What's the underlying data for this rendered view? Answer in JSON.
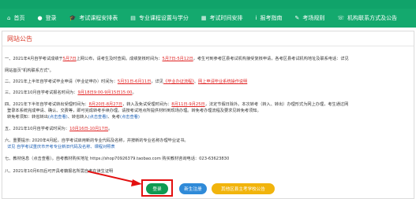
{
  "nav": {
    "items": [
      {
        "icon": "home-icon",
        "glyph": "⌂",
        "label": "首页"
      },
      {
        "icon": "user-icon",
        "glyph": "●",
        "label": "登录"
      },
      {
        "icon": "cap-icon",
        "glyph": "🎓",
        "label": "考试课程安排表"
      },
      {
        "icon": "book-icon",
        "glyph": "▤",
        "label": "专业课程设置与学分"
      },
      {
        "icon": "calendar-icon",
        "glyph": "▦",
        "label": "考试时间安排"
      },
      {
        "icon": "info-icon",
        "glyph": "i",
        "label": "报考指南"
      },
      {
        "icon": "pencil-icon",
        "glyph": "✎",
        "label": "考场规则"
      },
      {
        "icon": "phone-icon",
        "glyph": "☏",
        "label": "机构联系方式及公告"
      }
    ]
  },
  "notice": {
    "title": "网站公告",
    "lines": [
      [
        {
          "t": "一、2021年4月自学考试成绩于"
        },
        {
          "t": "5月7日",
          "c": "red ul"
        },
        {
          "t": "上网公布，请考生及时查阅。成绩复核时间为："
        },
        {
          "t": "5月7日-5月12日",
          "c": "red ul"
        },
        {
          "t": "，考生可到参考区县考试机构接受复核申请，各考区县考试机构地址及联系电话：详见"
        }
      ],
      [
        {
          "t": "网站首页\"机构联系方式\"。"
        }
      ],
      [
        {
          "t": "二、2021年上半年自学考试毕业申请（毕业证申办）时间为："
        },
        {
          "t": "5月31日-6月11日",
          "c": "red ul"
        },
        {
          "t": "，详见"
        },
        {
          "t": "《毕业办证流程》",
          "c": "red ul"
        },
        {
          "t": "、"
        },
        {
          "t": "网上申请毕业系统操作说明",
          "c": "red ul"
        }
      ],
      [
        {
          "t": "三、2021年10月自学考试报名时间为："
        },
        {
          "t": "9月18日9:00-9月15日15:00",
          "c": "red ul"
        },
        {
          "t": "。"
        }
      ],
      [
        {
          "t": "四、2021年下半年自学考试转出受理时间为："
        },
        {
          "t": "8月20日-8月27日",
          "c": "red ul"
        },
        {
          "t": "，转入及免试受理时间为："
        },
        {
          "t": "8月11日-9月25日",
          "c": "red ul"
        },
        {
          "t": "，法定节假日除外。本次转考（转入、转出）办理形式为网上办理，考生通过网"
        }
      ],
      [
        {
          "t": "登录本系统完成申请、确认、交费等，即可完成转考手续办理。请按考试地点所提供材料到现场办理。转免考办理流程及要求见转免考须知。"
        }
      ],
      [
        {
          "t": "转免考须知：转省转出"
        },
        {
          "t": "(点击查看)",
          "c": "blue"
        },
        {
          "t": "、转省转入"
        },
        {
          "t": "(点击查看)",
          "c": "blue"
        },
        {
          "t": "、免考"
        },
        {
          "t": "(点击查看)",
          "c": "blue"
        }
      ],
      [
        {
          "t": "五、2021年10月自学考试时间为："
        },
        {
          "t": "10月16日-10月17日",
          "c": "red ul"
        },
        {
          "t": "。"
        }
      ],
      [
        {
          "t": "六、重要提示: 2020年4月起，自学考试启用新的专业代码及名称，并按新的专业名称办理毕业证书。"
        }
      ],
      [
        {
          "t": "详见 自学考试重庆市开考专业新旧代码及名称、课程对照表",
          "c": "blue"
        }
      ],
      [
        {
          "t": "七、教材信息（点击查看）。自考教材购买地址 https://shop70926379.taobao.com 购买教材咨询电话：023-63623830"
        }
      ],
      [
        {
          "t": "八、2021年10月6日后可开具考籍报名所需自考在读生证明"
        }
      ]
    ]
  },
  "buttons": {
    "login": "登录",
    "register": "新生注册",
    "other": "其他区县主考学校公告"
  },
  "colors": {
    "nav_bg": "#14a96e",
    "title_red": "#d93b2b",
    "login_green": "#0f9a52",
    "register_blue": "#2f8ad8",
    "other_yellow": "#f1b40c",
    "annotation_red": "#e31010"
  }
}
